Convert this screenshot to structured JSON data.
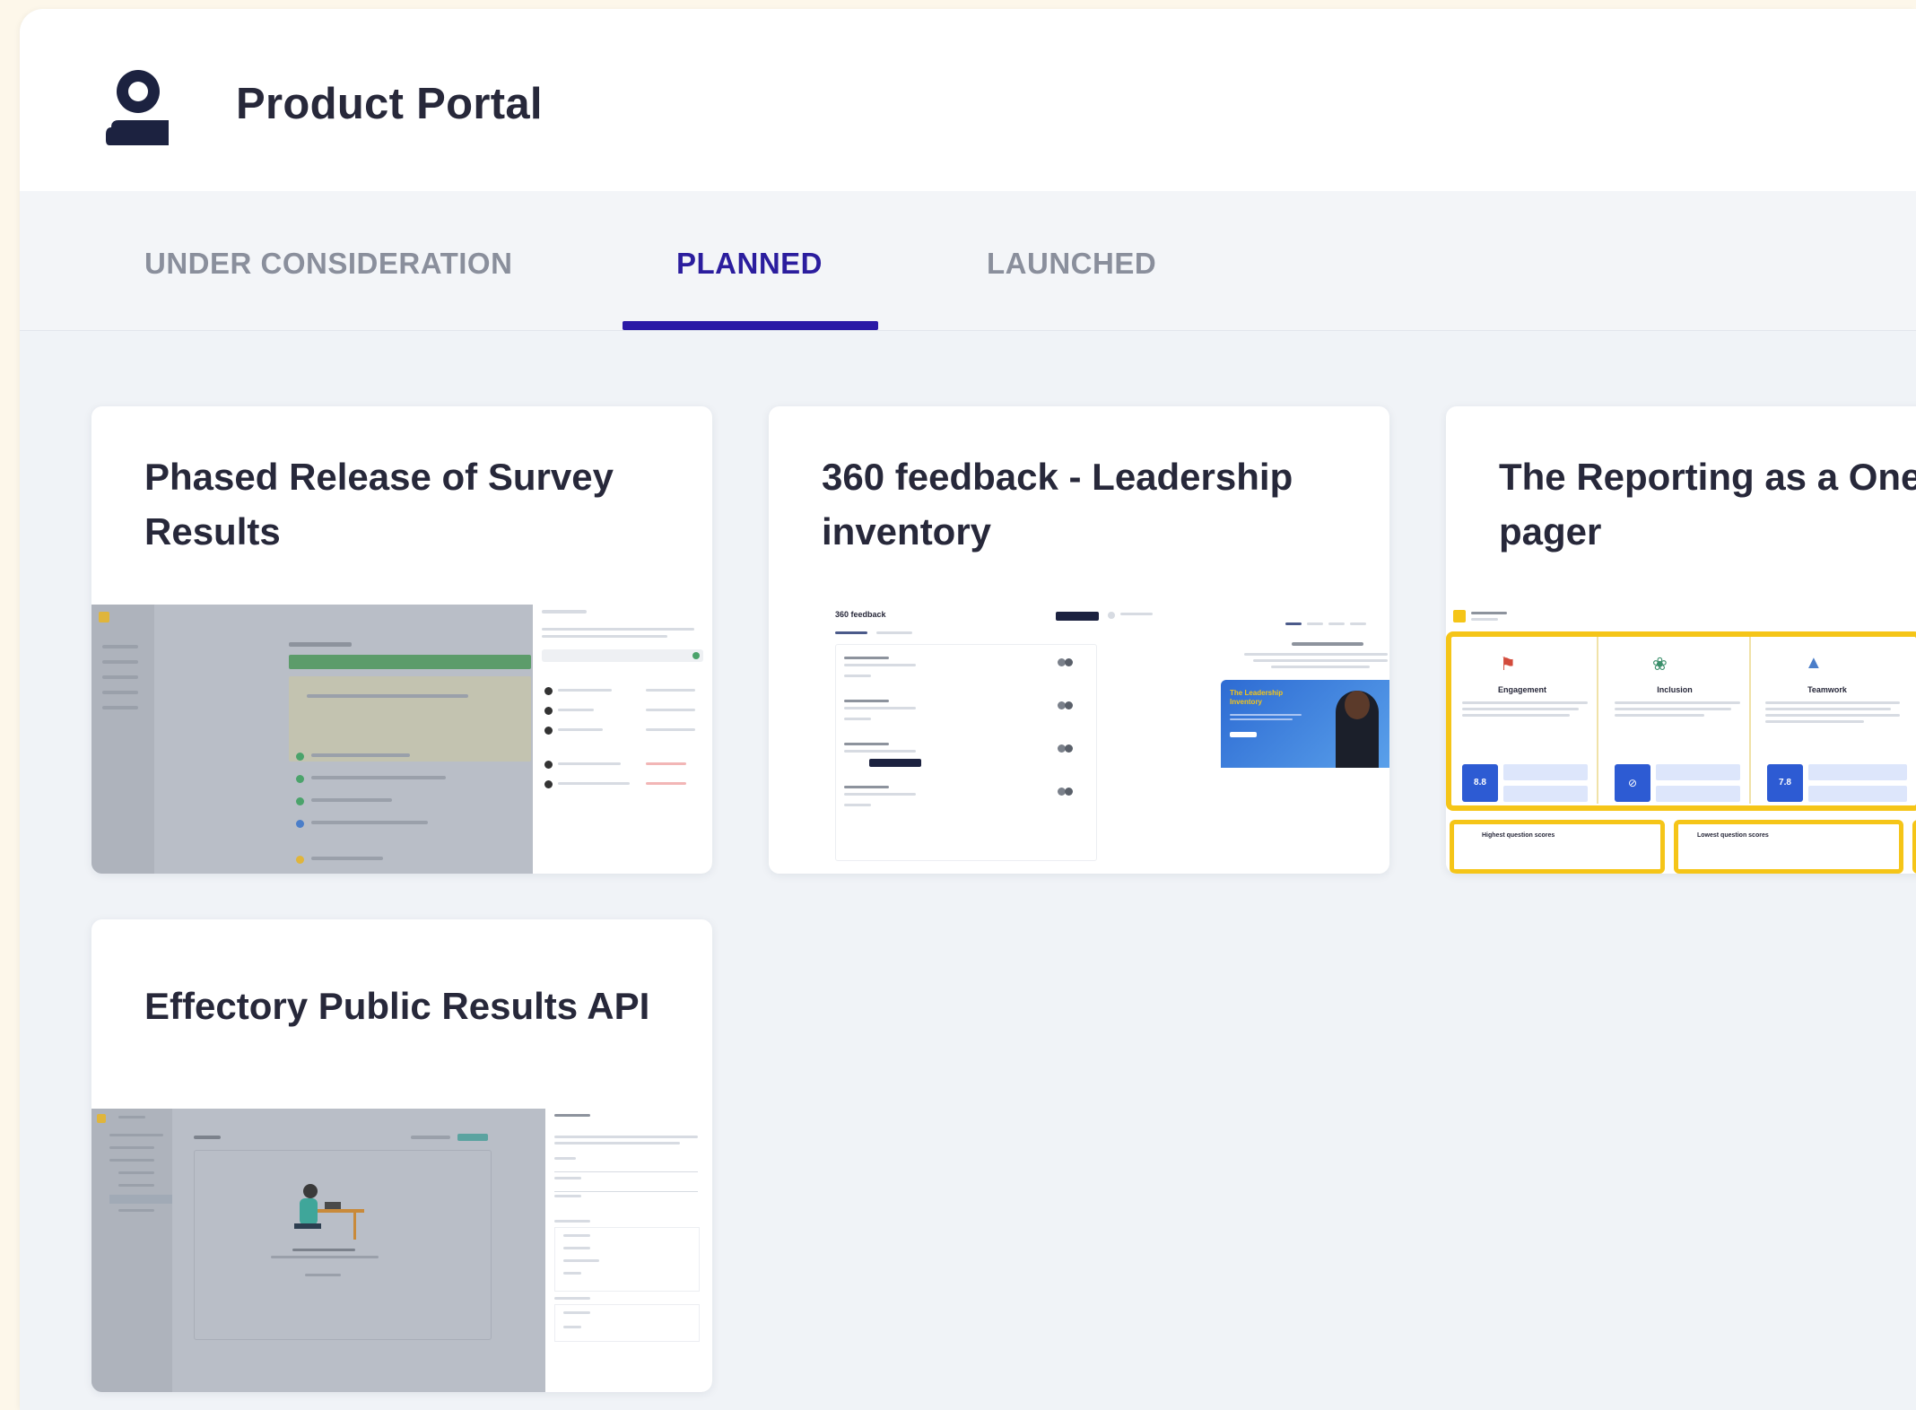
{
  "header": {
    "title": "Product Portal",
    "logo_icon": "person-icon"
  },
  "tabs": [
    {
      "label": "UNDER CONSIDERATION",
      "active": false
    },
    {
      "label": "PLANNED",
      "active": true
    },
    {
      "label": "LAUNCHED",
      "active": false
    }
  ],
  "cards": [
    {
      "title": "Phased Release of Survey\nResults"
    },
    {
      "title": "360 feedback - Leadership\ninventory"
    },
    {
      "title": "The Reporting as a One\npager"
    },
    {
      "title": "Effectory Public Results API"
    }
  ],
  "thumbnails": {
    "feedback": {
      "heading": "360 feedback",
      "banner_title": "The Leadership Inventory"
    },
    "reporting": {
      "columns": [
        {
          "label": "Engagement",
          "score": "8.8"
        },
        {
          "label": "Inclusion",
          "score": ""
        },
        {
          "label": "Teamwork",
          "score": "7.8"
        }
      ],
      "highest_label": "Highest question scores",
      "lowest_label": "Lowest question scores"
    }
  },
  "colors": {
    "accent": "#2b1aa6",
    "tab_active_text": "#2b1d9e",
    "tab_inactive_text": "#8a8f9c",
    "card_title": "#27283a",
    "highlight_yellow": "#f5c518",
    "score_blue": "#2d5bd3",
    "green_bar": "#4ba36b"
  }
}
